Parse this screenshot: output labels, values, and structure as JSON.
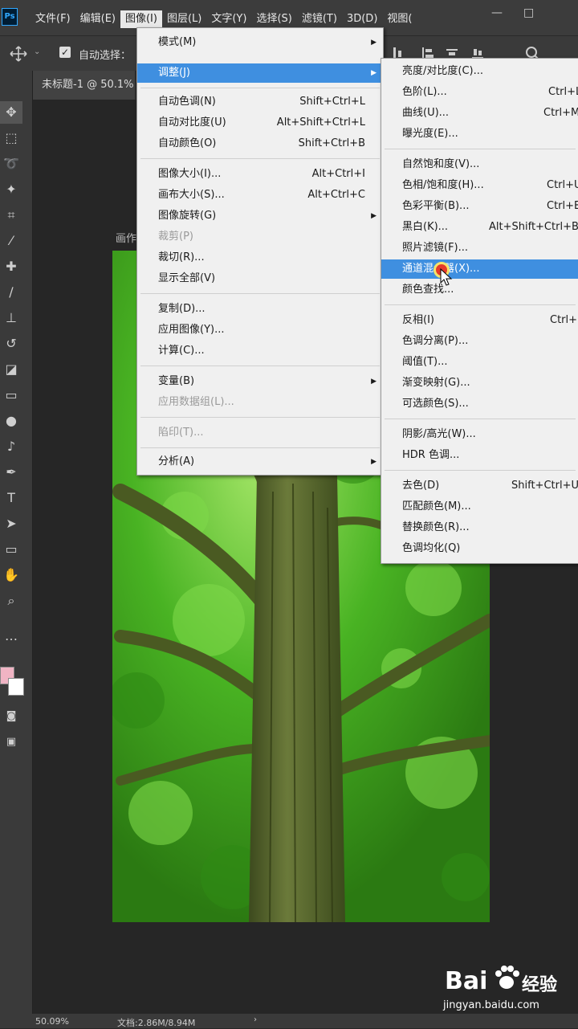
{
  "app": {
    "logo": "Ps"
  },
  "menubar": {
    "items": [
      "文件(F)",
      "编辑(E)",
      "图像(I)",
      "图层(L)",
      "文字(Y)",
      "选择(S)",
      "滤镜(T)",
      "3D(D)",
      "视图("
    ],
    "window_controls": [
      "—",
      "□"
    ]
  },
  "options": {
    "auto_select_label": "自动选择：",
    "check": "✓"
  },
  "document": {
    "tab": "未标题-1 @ 50.1%",
    "canvas_label": "画作",
    "zoom": "50.09%",
    "doc_info": "文档:2.86M/8.94M"
  },
  "image_menu": {
    "items": [
      {
        "label": "模式(M)",
        "shortcut": "",
        "submenu": true
      },
      {
        "label": "调整(J)",
        "shortcut": "",
        "submenu": true,
        "highlight": true
      },
      {
        "label": "自动色调(N)",
        "shortcut": "Shift+Ctrl+L"
      },
      {
        "label": "自动对比度(U)",
        "shortcut": "Alt+Shift+Ctrl+L"
      },
      {
        "label": "自动颜色(O)",
        "shortcut": "Shift+Ctrl+B"
      },
      {
        "label": "图像大小(I)...",
        "shortcut": "Alt+Ctrl+I"
      },
      {
        "label": "画布大小(S)...",
        "shortcut": "Alt+Ctrl+C"
      },
      {
        "label": "图像旋转(G)",
        "shortcut": "",
        "submenu": true
      },
      {
        "label": "裁剪(P)",
        "shortcut": "",
        "disabled": true
      },
      {
        "label": "裁切(R)...",
        "shortcut": ""
      },
      {
        "label": "显示全部(V)",
        "shortcut": ""
      },
      {
        "label": "复制(D)...",
        "shortcut": ""
      },
      {
        "label": "应用图像(Y)...",
        "shortcut": ""
      },
      {
        "label": "计算(C)...",
        "shortcut": ""
      },
      {
        "label": "变量(B)",
        "shortcut": "",
        "submenu": true
      },
      {
        "label": "应用数据组(L)...",
        "shortcut": "",
        "disabled": true
      },
      {
        "label": "陷印(T)...",
        "shortcut": "",
        "disabled": true
      },
      {
        "label": "分析(A)",
        "shortcut": "",
        "submenu": true
      }
    ]
  },
  "adjust_menu": {
    "items": [
      {
        "label": "亮度/对比度(C)...",
        "shortcut": ""
      },
      {
        "label": "色阶(L)...",
        "shortcut": "Ctrl+L"
      },
      {
        "label": "曲线(U)...",
        "shortcut": "Ctrl+M"
      },
      {
        "label": "曝光度(E)...",
        "shortcut": ""
      },
      {
        "label": "自然饱和度(V)...",
        "shortcut": ""
      },
      {
        "label": "色相/饱和度(H)...",
        "shortcut": "Ctrl+U"
      },
      {
        "label": "色彩平衡(B)...",
        "shortcut": "Ctrl+B"
      },
      {
        "label": "黑白(K)...",
        "shortcut": "Alt+Shift+Ctrl+B"
      },
      {
        "label": "照片滤镜(F)...",
        "shortcut": ""
      },
      {
        "label": "通道混合器(X)...",
        "shortcut": "",
        "highlight": true
      },
      {
        "label": "颜色查找...",
        "shortcut": ""
      },
      {
        "label": "反相(I)",
        "shortcut": "Ctrl+I"
      },
      {
        "label": "色调分离(P)...",
        "shortcut": ""
      },
      {
        "label": "阈值(T)...",
        "shortcut": ""
      },
      {
        "label": "渐变映射(G)...",
        "shortcut": ""
      },
      {
        "label": "可选颜色(S)...",
        "shortcut": ""
      },
      {
        "label": "阴影/高光(W)...",
        "shortcut": ""
      },
      {
        "label": "HDR 色调...",
        "shortcut": ""
      },
      {
        "label": "去色(D)",
        "shortcut": "Shift+Ctrl+U"
      },
      {
        "label": "匹配颜色(M)...",
        "shortcut": ""
      },
      {
        "label": "替换颜色(R)...",
        "shortcut": ""
      },
      {
        "label": "色调均化(Q)",
        "shortcut": ""
      }
    ]
  },
  "watermark": {
    "brand": "Bai",
    "brand2": "经验",
    "url": "jingyan.baidu.com"
  },
  "colors": {
    "accent": "#3f8fe0",
    "foreground_swatch": "#f0b4c4"
  }
}
